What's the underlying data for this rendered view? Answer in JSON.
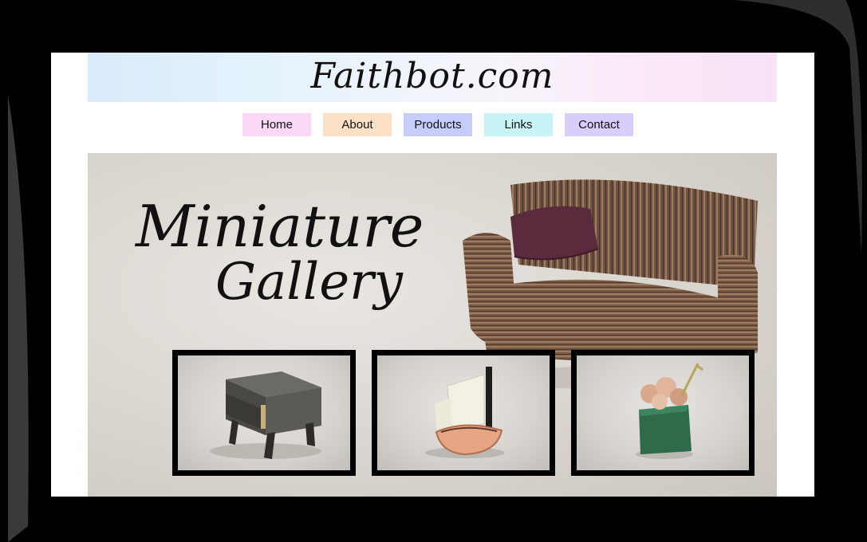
{
  "site": {
    "title": "Faithbot.com"
  },
  "nav": {
    "items": [
      {
        "label": "Home",
        "color": "#f9d9f7"
      },
      {
        "label": "About",
        "color": "#fbe0c6"
      },
      {
        "label": "Products",
        "color": "#c7cdfa"
      },
      {
        "label": "Links",
        "color": "#c8f3f7"
      },
      {
        "label": "Contact",
        "color": "#d9cdfb"
      }
    ]
  },
  "hero": {
    "title_line1": "Miniature",
    "title_line2": "Gallery",
    "sofa_image": "miniature-sofa-photo"
  },
  "thumbnails": [
    {
      "name": "miniature-dresser-photo"
    },
    {
      "name": "miniature-boat-photo"
    },
    {
      "name": "miniature-flower-pot-photo"
    }
  ]
}
